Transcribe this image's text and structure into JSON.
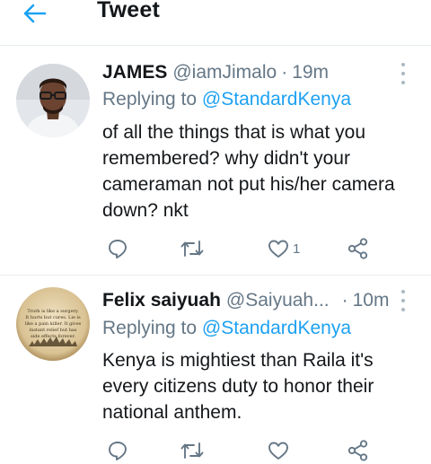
{
  "header": {
    "title": "Tweet"
  },
  "tweets": [
    {
      "name": "JAMES",
      "handle": "@iamJimalo",
      "separator": "·",
      "time": "19m",
      "reply_prefix": "Replying to",
      "reply_to": "@StandardKenya",
      "text": "of all the things that is what you remembered? why didn't your cameraman not put his/her camera down? nkt",
      "like_count": "1"
    },
    {
      "name": "Felix saiyuah",
      "handle": "@Saiyuah...",
      "separator": "·",
      "time": "10m",
      "reply_prefix": "Replying to",
      "reply_to": "@StandardKenya",
      "text": "Kenya is mightiest than Raila it's every citizens duty to honor their national anthem.",
      "like_count": "",
      "avatar_quote": [
        "Truth is like a surgery.",
        "It hurts but cures. Lie is",
        "like a pain killer. It gives",
        "instant relief but has",
        "side effects forever."
      ]
    }
  ],
  "colors": {
    "accent": "#1da1f2",
    "muted": "#657786",
    "text": "#14171a",
    "divider": "#e6ecf0"
  },
  "icons": [
    "back-arrow-icon",
    "more-icon",
    "reply-icon",
    "retweet-icon",
    "like-icon",
    "share-icon"
  ]
}
